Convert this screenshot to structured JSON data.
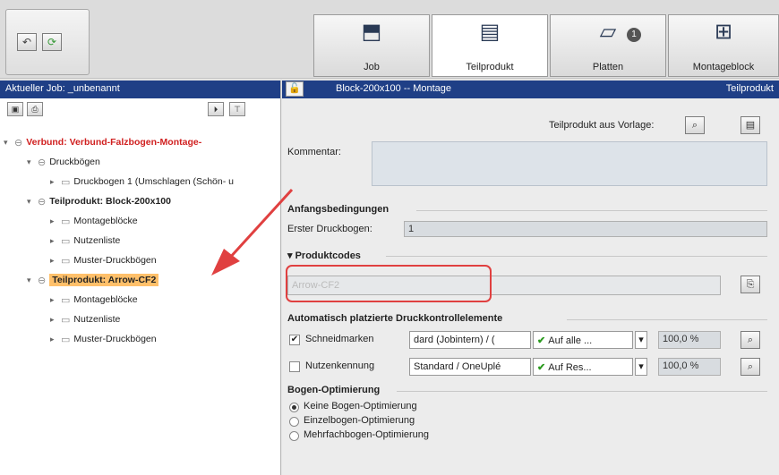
{
  "toolbar": {
    "back_icon": "undo-icon",
    "refresh_icon": "refresh-icon"
  },
  "tabs": [
    {
      "label": "Job",
      "icon": "job-icon"
    },
    {
      "label": "Teilprodukt",
      "icon": "teilprodukt-icon"
    },
    {
      "label": "Platten",
      "icon": "platten-icon",
      "badge": "1"
    },
    {
      "label": "Montageblock",
      "icon": "montageblock-icon"
    }
  ],
  "left": {
    "header": "Aktueller Job: _unbenannt",
    "tree": [
      {
        "label": "Verbund: Verbund-Falzbogen-Montage-"
      },
      {
        "label": "Druckbögen"
      },
      {
        "label": "Druckbogen 1 (Umschlagen (Schön- u"
      },
      {
        "label": "Teilprodukt: Block-200x100"
      },
      {
        "label": "Montageblöcke"
      },
      {
        "label": "Nutzenliste"
      },
      {
        "label": "Muster-Druckbögen"
      },
      {
        "label": "Teilprodukt: Arrow-CF2"
      },
      {
        "label": "Montageblöcke"
      },
      {
        "label": "Nutzenliste"
      },
      {
        "label": "Muster-Druckbögen"
      }
    ]
  },
  "right": {
    "header_title": "Block-200x100 -- Montage",
    "header_right": "Teilprodukt",
    "vorlage_label": "Teilprodukt aus Vorlage:",
    "kommentar_label": "Kommentar:",
    "anfang_title": "Anfangsbedingungen",
    "erster_label": "Erster Druckbogen:",
    "erster_value": "1",
    "produktcodes_title": "Produktcodes",
    "produktcode_value": "Arrow-CF2",
    "auto_title": "Automatisch platzierte Druckkontrollelemente",
    "rows": [
      {
        "label": "Schneidmarken",
        "checked": "✔",
        "style": "dard (Jobintern) / (",
        "pos": "Auf alle ...",
        "pct": "100,0 %"
      },
      {
        "label": "Nutzenkennung",
        "checked": "",
        "style": "Standard / OneUplé",
        "pos": "Auf Res...",
        "pct": "100,0 %"
      }
    ],
    "opt_title": "Bogen-Optimierung",
    "opt_options": [
      "Keine Bogen-Optimierung",
      "Einzelbogen-Optimierung",
      "Mehrfachbogen-Optimierung"
    ]
  },
  "colors": {
    "header_blue": "#1f3f86",
    "tree_red": "#d02020",
    "highlight": "#ffc06a",
    "callout": "#e04040"
  }
}
